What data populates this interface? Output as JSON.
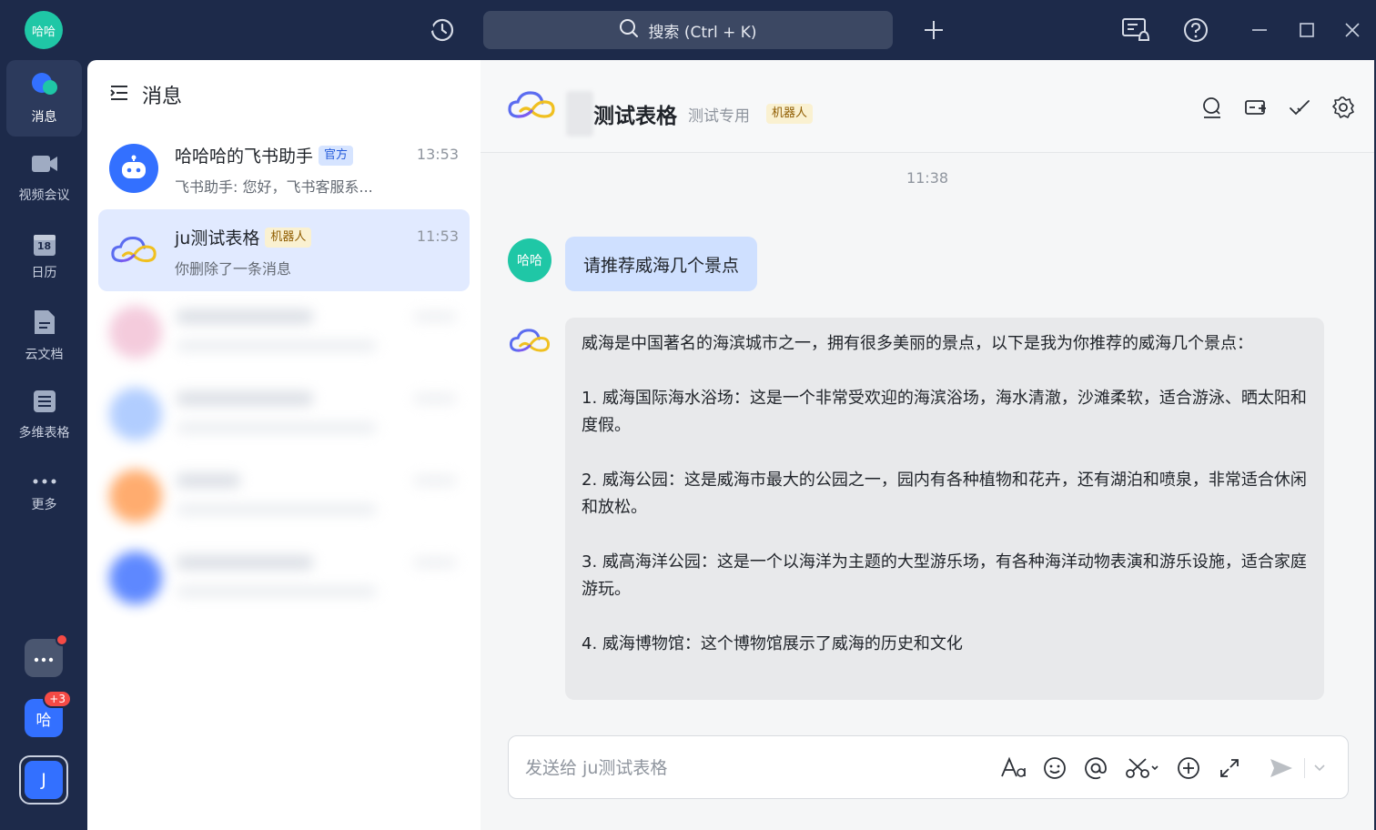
{
  "app": {
    "user_avatar_text": "哈哈",
    "search_placeholder": "搜索 (Ctrl + K)"
  },
  "nav": {
    "items": [
      {
        "label": "消息",
        "icon": "message-icon"
      },
      {
        "label": "视频会议",
        "icon": "video-icon"
      },
      {
        "label": "日历",
        "icon": "calendar-icon",
        "day": "18"
      },
      {
        "label": "云文档",
        "icon": "doc-icon"
      },
      {
        "label": "多维表格",
        "icon": "base-table-icon"
      },
      {
        "label": "更多",
        "icon": "more-icon"
      }
    ],
    "bottom": {
      "org_badge": "+3",
      "org_text": "哈",
      "account_text": "J"
    }
  },
  "list": {
    "title": "消息",
    "conversations": [
      {
        "name": "哈哈哈的飞书助手",
        "tag": "官方",
        "time": "13:53",
        "preview": "飞书助手: 您好，飞书客服系..."
      },
      {
        "name": "ju测试表格",
        "tag": "机器人",
        "time": "11:53",
        "preview": "你删除了一条消息"
      }
    ]
  },
  "chat": {
    "title": "测试表格",
    "description": "测试专用",
    "tag": "机器人",
    "time_separator": "11:38",
    "user_avatar_text": "哈哈",
    "user_message": "请推荐威海几个景点",
    "bot_paragraphs": [
      "威海是中国著名的海滨城市之一，拥有很多美丽的景点，以下是我为你推荐的威海几个景点：",
      "1. 威海国际海水浴场：这是一个非常受欢迎的海滨浴场，海水清澈，沙滩柔软，适合游泳、晒太阳和度假。",
      "2. 威海公园：这是威海市最大的公园之一，园内有各种植物和花卉，还有湖泊和喷泉，非常适合休闲和放松。",
      "3. 威高海洋公园：这是一个以海洋为主题的大型游乐场，有各种海洋动物表演和游乐设施，适合家庭游玩。",
      "4. 威海博物馆：这个博物馆展示了威海的历史和文化"
    ],
    "composer_placeholder": "发送给 ju测试表格"
  },
  "colors": {
    "sidebar": "#1d2a4a",
    "accent": "#3370ff",
    "teal": "#1fc7a6",
    "user_bubble": "#cfe0ff",
    "bot_bubble": "#e8e9eb"
  }
}
